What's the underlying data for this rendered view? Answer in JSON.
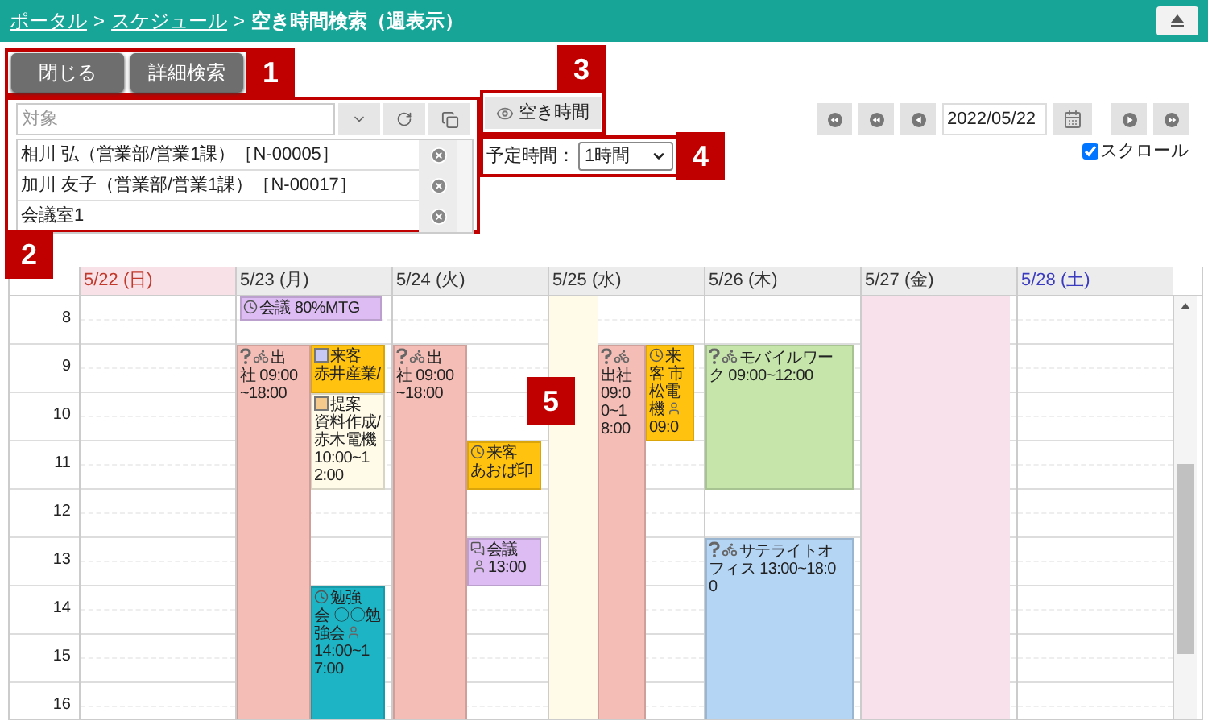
{
  "breadcrumb": [
    {
      "kind": "link",
      "text": "ポータル"
    },
    {
      "kind": "separator",
      "text": ">"
    },
    {
      "kind": "link",
      "text": "スケジュール"
    },
    {
      "kind": "separator",
      "text": ">"
    },
    {
      "kind": "current",
      "text": "空き時間検索（週表示）"
    }
  ],
  "buttons": [
    "閉じる",
    "詳細検索"
  ],
  "target": {
    "placeholder": "対象",
    "items": [
      "相川 弘（営業部/営業1課）［N-00005］",
      "加川 友子（営業部/営業1課）［N-00017］",
      "会議室1"
    ]
  },
  "free_time_button": "空き時間",
  "duration": {
    "label": "予定時間：",
    "value": "1時間"
  },
  "date_nav": {
    "date": "2022/05/22",
    "scroll": {
      "label": "スクロール",
      "checked": true
    }
  },
  "callouts": [
    "1",
    "2",
    "3",
    "4",
    "5"
  ],
  "calendar": {
    "hours": [
      "8",
      "9",
      "10",
      "11",
      "12",
      "13",
      "14",
      "15",
      "16"
    ],
    "days": [
      {
        "label": "5/22 (日)",
        "kind": "sunday"
      },
      {
        "label": "5/23 (月)",
        "kind": "weekday",
        "lanes": [
          [
            {
              "kind": "wide",
              "color": "#dcbcf2",
              "items": [
                {
                  "kind": "clock"
                },
                {
                  "kind": "text",
                  "text": "会議 80%MTG"
                }
              ]
            },
            {
              "kind": "gap"
            },
            {
              "kind": "event",
              "color": "#f4bdb5",
              "items": [
                {
                  "kind": "question"
                },
                {
                  "kind": "bike"
                },
                {
                  "kind": "text",
                  "text": "出"
                },
                {
                  "kind": "br"
                },
                {
                  "kind": "text",
                  "text": "社 09:00"
                },
                {
                  "kind": "br"
                },
                {
                  "kind": "text",
                  "text": "~18:00"
                }
              ]
            },
            {
              "kind": "more"
            },
            {
              "kind": "more"
            },
            {
              "kind": "more"
            },
            {
              "kind": "more"
            },
            {
              "kind": "more"
            },
            {
              "kind": "more"
            },
            {
              "kind": "more"
            },
            {
              "kind": "more"
            },
            {
              "kind": "more"
            },
            {
              "kind": "more"
            },
            {
              "kind": "more"
            },
            {
              "kind": "more"
            },
            {
              "kind": "more"
            },
            {
              "kind": "more"
            },
            {
              "kind": "more"
            }
          ],
          [
            {
              "kind": "gap"
            },
            {
              "kind": "gap"
            },
            {
              "kind": "event",
              "color": "#ffc20e",
              "items": [
                {
                  "kind": "square",
                  "color": "#c8c8f4"
                },
                {
                  "kind": "text",
                  "text": "来客"
                },
                {
                  "kind": "br"
                },
                {
                  "kind": "text",
                  "text": "赤井産業/"
                }
              ]
            },
            {
              "kind": "more"
            },
            {
              "kind": "event",
              "color": "#fffbe8",
              "items": [
                {
                  "kind": "square",
                  "color": "#f5c98c"
                },
                {
                  "kind": "text",
                  "text": "提案"
                },
                {
                  "kind": "br"
                },
                {
                  "kind": "text",
                  "text": "資料作成/"
                },
                {
                  "kind": "br"
                },
                {
                  "kind": "text",
                  "text": "赤木電機"
                },
                {
                  "kind": "br"
                },
                {
                  "kind": "text",
                  "text": "10:00~1"
                },
                {
                  "kind": "br"
                },
                {
                  "kind": "text",
                  "text": "2:00"
                }
              ]
            },
            {
              "kind": "more"
            },
            {
              "kind": "more"
            },
            {
              "kind": "more"
            },
            {
              "kind": "gap"
            },
            {
              "kind": "gap"
            },
            {
              "kind": "gap"
            },
            {
              "kind": "gap"
            },
            {
              "kind": "event",
              "color": "#1db5c6",
              "items": [
                {
                  "kind": "clock"
                },
                {
                  "kind": "text",
                  "text": "勉強"
                },
                {
                  "kind": "br"
                },
                {
                  "kind": "text",
                  "text": "会 〇〇勉"
                },
                {
                  "kind": "br"
                },
                {
                  "kind": "text",
                  "text": "強会"
                },
                {
                  "kind": "person"
                },
                {
                  "kind": "br"
                },
                {
                  "kind": "text",
                  "text": "14:00~1"
                },
                {
                  "kind": "br"
                },
                {
                  "kind": "text",
                  "text": "7:00"
                }
              ]
            },
            {
              "kind": "more"
            },
            {
              "kind": "more"
            },
            {
              "kind": "more"
            },
            {
              "kind": "more"
            },
            {
              "kind": "more"
            }
          ]
        ]
      },
      {
        "label": "5/24 (火)",
        "kind": "weekday",
        "lanes": [
          [
            {
              "kind": "gap"
            },
            {
              "kind": "gap"
            },
            {
              "kind": "event",
              "color": "#f4bdb5",
              "items": [
                {
                  "kind": "question"
                },
                {
                  "kind": "bike"
                },
                {
                  "kind": "text",
                  "text": "出"
                },
                {
                  "kind": "br"
                },
                {
                  "kind": "text",
                  "text": "社 09:00"
                },
                {
                  "kind": "br"
                },
                {
                  "kind": "text",
                  "text": "~18:00"
                }
              ]
            },
            {
              "kind": "more"
            },
            {
              "kind": "more"
            },
            {
              "kind": "more"
            },
            {
              "kind": "more"
            },
            {
              "kind": "more"
            },
            {
              "kind": "more"
            },
            {
              "kind": "more"
            },
            {
              "kind": "more"
            },
            {
              "kind": "more"
            },
            {
              "kind": "more"
            },
            {
              "kind": "more"
            },
            {
              "kind": "more"
            },
            {
              "kind": "more"
            },
            {
              "kind": "more"
            },
            {
              "kind": "more"
            }
          ],
          [
            {
              "kind": "gap"
            },
            {
              "kind": "gap"
            },
            {
              "kind": "gap"
            },
            {
              "kind": "gap"
            },
            {
              "kind": "gap"
            },
            {
              "kind": "gap"
            },
            {
              "kind": "event",
              "color": "#ffc20e",
              "items": [
                {
                  "kind": "clock"
                },
                {
                  "kind": "text",
                  "text": "来客"
                },
                {
                  "kind": "br"
                },
                {
                  "kind": "text",
                  "text": "あおば印"
                }
              ]
            },
            {
              "kind": "more"
            },
            {
              "kind": "gap"
            },
            {
              "kind": "gap"
            },
            {
              "kind": "event",
              "color": "#dcbcf2",
              "items": [
                {
                  "kind": "chat"
                },
                {
                  "kind": "text",
                  "text": "会議"
                },
                {
                  "kind": "br"
                },
                {
                  "kind": "person"
                },
                {
                  "kind": "text",
                  "text": "13:00"
                }
              ]
            },
            {
              "kind": "more"
            }
          ]
        ]
      },
      {
        "label": "5/25 (水)",
        "kind": "weekday",
        "lanes": [
          [
            {
              "kind": "band",
              "color": "#fffbe8"
            },
            {
              "kind": "more"
            },
            {
              "kind": "more"
            },
            {
              "kind": "more"
            },
            {
              "kind": "more"
            },
            {
              "kind": "more"
            },
            {
              "kind": "more"
            },
            {
              "kind": "more"
            },
            {
              "kind": "more"
            },
            {
              "kind": "more"
            },
            {
              "kind": "more"
            },
            {
              "kind": "more"
            },
            {
              "kind": "more"
            },
            {
              "kind": "more"
            },
            {
              "kind": "more"
            },
            {
              "kind": "more"
            },
            {
              "kind": "more"
            },
            {
              "kind": "more"
            }
          ],
          [
            {
              "kind": "gap"
            },
            {
              "kind": "gap"
            },
            {
              "kind": "event",
              "color": "#f4bdb5",
              "items": [
                {
                  "kind": "question"
                },
                {
                  "kind": "bike"
                },
                {
                  "kind": "br"
                },
                {
                  "kind": "text",
                  "text": "出社"
                },
                {
                  "kind": "br"
                },
                {
                  "kind": "text",
                  "text": "09:0"
                },
                {
                  "kind": "br"
                },
                {
                  "kind": "text",
                  "text": "0~1"
                },
                {
                  "kind": "br"
                },
                {
                  "kind": "text",
                  "text": "8:00"
                }
              ]
            },
            {
              "kind": "more"
            },
            {
              "kind": "more"
            },
            {
              "kind": "more"
            },
            {
              "kind": "more"
            },
            {
              "kind": "more"
            },
            {
              "kind": "more"
            },
            {
              "kind": "more"
            },
            {
              "kind": "more"
            },
            {
              "kind": "more"
            },
            {
              "kind": "more"
            },
            {
              "kind": "more"
            },
            {
              "kind": "more"
            },
            {
              "kind": "more"
            },
            {
              "kind": "more"
            },
            {
              "kind": "more"
            }
          ],
          [
            {
              "kind": "gap"
            },
            {
              "kind": "gap"
            },
            {
              "kind": "event",
              "color": "#ffc20e",
              "items": [
                {
                  "kind": "clock"
                },
                {
                  "kind": "text",
                  "text": "来"
                },
                {
                  "kind": "br"
                },
                {
                  "kind": "text",
                  "text": "客 市"
                },
                {
                  "kind": "br"
                },
                {
                  "kind": "text",
                  "text": "松電"
                },
                {
                  "kind": "br"
                },
                {
                  "kind": "text",
                  "text": "機"
                },
                {
                  "kind": "person"
                },
                {
                  "kind": "br"
                },
                {
                  "kind": "text",
                  "text": "09:0"
                }
              ]
            },
            {
              "kind": "more"
            },
            {
              "kind": "more"
            },
            {
              "kind": "more"
            }
          ]
        ]
      },
      {
        "label": "5/26 (木)",
        "kind": "weekday",
        "lanes": [
          [
            {
              "kind": "gap"
            },
            {
              "kind": "gap"
            },
            {
              "kind": "event",
              "color": "#c5e5ab",
              "items": [
                {
                  "kind": "question"
                },
                {
                  "kind": "bike"
                },
                {
                  "kind": "text",
                  "text": "モバイルワー"
                },
                {
                  "kind": "br"
                },
                {
                  "kind": "text",
                  "text": "ク 09:00~12:00"
                }
              ]
            },
            {
              "kind": "more"
            },
            {
              "kind": "more"
            },
            {
              "kind": "more"
            },
            {
              "kind": "more"
            },
            {
              "kind": "more"
            },
            {
              "kind": "gap"
            },
            {
              "kind": "gap"
            },
            {
              "kind": "event",
              "color": "#b5d5f5",
              "items": [
                {
                  "kind": "question"
                },
                {
                  "kind": "bike"
                },
                {
                  "kind": "text",
                  "text": "サテライトオ"
                },
                {
                  "kind": "br"
                },
                {
                  "kind": "text",
                  "text": "フィス 13:00~18:0"
                },
                {
                  "kind": "br"
                },
                {
                  "kind": "text",
                  "text": "0"
                }
              ]
            },
            {
              "kind": "more"
            },
            {
              "kind": "more"
            },
            {
              "kind": "more"
            },
            {
              "kind": "more"
            },
            {
              "kind": "more"
            },
            {
              "kind": "more"
            },
            {
              "kind": "more"
            }
          ]
        ]
      },
      {
        "label": "5/27 (金)",
        "kind": "weekday",
        "lanes": [
          [
            {
              "kind": "band",
              "color": "#f8e1ea"
            },
            {
              "kind": "more"
            },
            {
              "kind": "more"
            },
            {
              "kind": "more"
            },
            {
              "kind": "more"
            },
            {
              "kind": "more"
            },
            {
              "kind": "more"
            },
            {
              "kind": "more"
            },
            {
              "kind": "more"
            },
            {
              "kind": "more"
            },
            {
              "kind": "more"
            },
            {
              "kind": "more"
            },
            {
              "kind": "more"
            },
            {
              "kind": "more"
            },
            {
              "kind": "more"
            },
            {
              "kind": "more"
            },
            {
              "kind": "more"
            },
            {
              "kind": "more"
            }
          ]
        ]
      },
      {
        "label": "5/28 (土)",
        "kind": "saturday"
      }
    ]
  }
}
